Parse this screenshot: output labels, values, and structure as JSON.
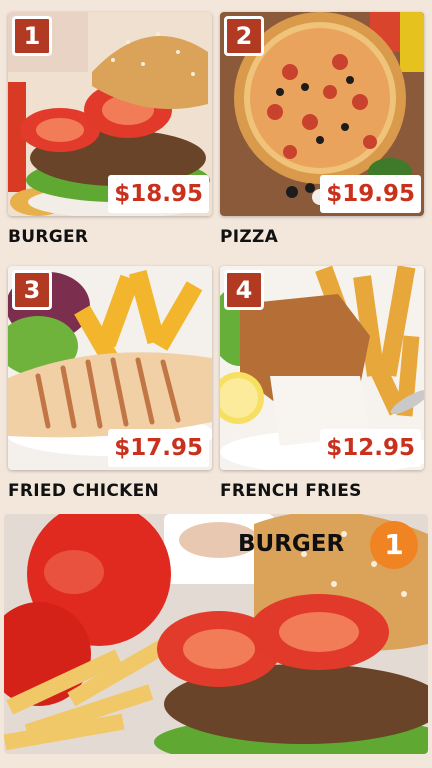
{
  "menu": {
    "items": [
      {
        "number": "1",
        "name": "BURGER",
        "price": "$18.95"
      },
      {
        "number": "2",
        "name": "PIZZA",
        "price": "$19.95"
      },
      {
        "number": "3",
        "name": "FRIED CHICKEN",
        "price": "$17.95"
      },
      {
        "number": "4",
        "name": "FRENCH FRIES",
        "price": "$12.95"
      }
    ]
  },
  "featured": {
    "title": "BURGER",
    "number": "1"
  },
  "colors": {
    "background": "#f3e7dc",
    "number_badge": "#b23a22",
    "price_text": "#c9311d",
    "featured_badge": "#f08422"
  }
}
